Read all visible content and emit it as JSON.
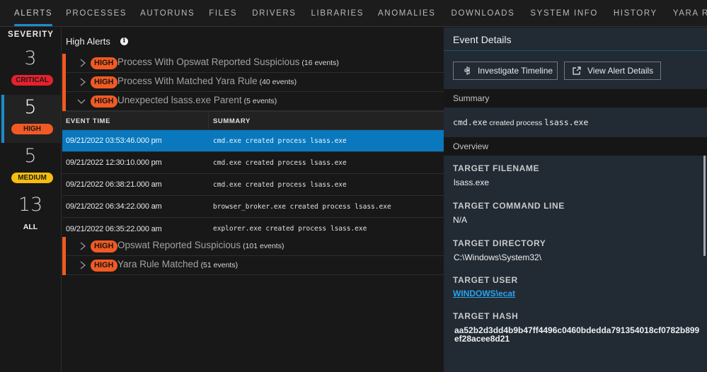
{
  "nav": {
    "tabs": [
      {
        "label": "ALERTS",
        "active": true
      },
      {
        "label": "PROCESSES"
      },
      {
        "label": "AUTORUNS"
      },
      {
        "label": "FILES"
      },
      {
        "label": "DRIVERS"
      },
      {
        "label": "LIBRARIES"
      },
      {
        "label": "ANOMALIES"
      },
      {
        "label": "DOWNLOADS"
      },
      {
        "label": "SYSTEM INFO"
      },
      {
        "label": "HISTORY"
      },
      {
        "label": "YARA RULES"
      }
    ]
  },
  "severity": {
    "title": "SEVERITY",
    "items": [
      {
        "count": "3",
        "label": "CRITICAL",
        "color": "#e8202d"
      },
      {
        "count": "5",
        "label": "HIGH",
        "color": "#f15a22",
        "active": true
      },
      {
        "count": "5",
        "label": "MEDIUM",
        "color": "#f5be0b"
      },
      {
        "count": "13",
        "label": "ALL"
      }
    ]
  },
  "alerts": {
    "title": "High Alerts",
    "info_icon": "info-icon",
    "groups": [
      {
        "severity": "HIGH",
        "name": "Process With Opswat Reported Suspicious",
        "count": "(16 events)",
        "expanded": false
      },
      {
        "severity": "HIGH",
        "name": "Process With Matched Yara Rule",
        "count": "(40 events)",
        "expanded": false
      },
      {
        "severity": "HIGH",
        "name": "Unexpected lsass.exe Parent",
        "count": "(5 events)",
        "expanded": true
      },
      {
        "severity": "HIGH",
        "name": "Opswat Reported Suspicious",
        "count": "(101 events)",
        "expanded": false
      },
      {
        "severity": "HIGH",
        "name": "Yara Rule Matched",
        "count": "(51 events)",
        "expanded": false
      }
    ],
    "table": {
      "columns": [
        "EVENT TIME",
        "SUMMARY"
      ],
      "rows": [
        {
          "time": "09/21/2022 03:53:46.000 pm",
          "summary": "cmd.exe created process lsass.exe",
          "selected": true
        },
        {
          "time": "09/21/2022 12:30:10.000 pm",
          "summary": "cmd.exe created process lsass.exe"
        },
        {
          "time": "09/21/2022 06:38:21.000 am",
          "summary": "cmd.exe created process lsass.exe"
        },
        {
          "time": "09/21/2022 06:34:22.000 am",
          "summary": "browser_broker.exe created process lsass.exe"
        },
        {
          "time": "09/21/2022 06:35:22.000 am",
          "summary": "explorer.exe created process lsass.exe"
        }
      ]
    },
    "accent": "#f15a22",
    "selected_row_color": "#0a78bd"
  },
  "details": {
    "title": "Event Details",
    "buttons": {
      "investigate": "Investigate Timeline",
      "view_alert": "View Alert Details"
    },
    "summary_label": "Summary",
    "summary": {
      "source": "cmd.exe",
      "verb": "created process",
      "target": "lsass.exe"
    },
    "overview_label": "Overview",
    "fields": [
      {
        "label": "TARGET FILENAME",
        "value": "lsass.exe"
      },
      {
        "label": "TARGET COMMAND LINE",
        "value": "N/A"
      },
      {
        "label": "TARGET DIRECTORY",
        "value": "C:\\Windows\\System32\\"
      },
      {
        "label": "TARGET USER",
        "value": "WINDOWS\\ecat",
        "link": true
      },
      {
        "label": "TARGET HASH",
        "value": "aa52b2d3dd4b9b47ff4496c0460bdedda791354018cf0782b899ef28acee8d21"
      }
    ],
    "link_color": "#2aa3ef"
  }
}
